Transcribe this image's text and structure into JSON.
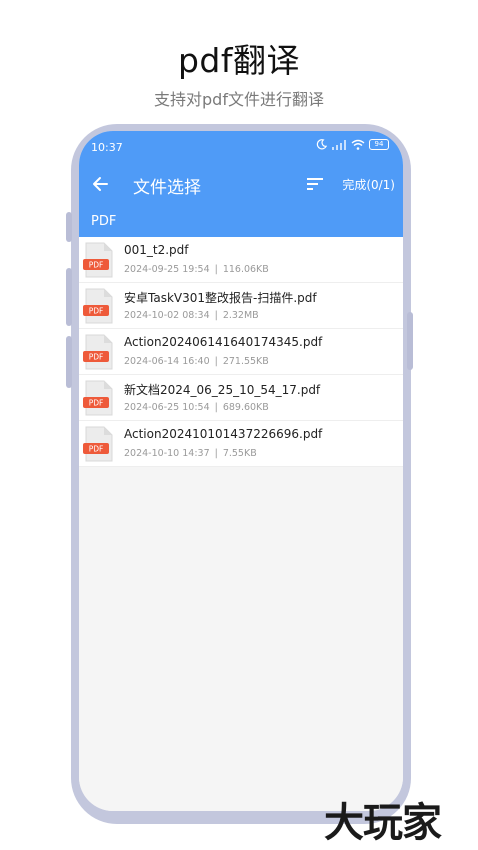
{
  "promo": {
    "title": "pdf翻译",
    "subtitle": "支持对pdf文件进行翻译"
  },
  "status_bar": {
    "time": "10:37",
    "battery": "94"
  },
  "toolbar": {
    "back_icon": "arrow-left-icon",
    "title": "文件选择",
    "sort_icon": "sort-icon",
    "done_label": "完成(0/1)"
  },
  "breadcrumb": "PDF",
  "files": [
    {
      "name": "001_t2.pdf",
      "date": "2024-09-25 19:54",
      "size": "116.06KB",
      "icon_label": "PDF"
    },
    {
      "name": "安卓TaskV301整改报告-扫描件.pdf",
      "date": "2024-10-02 08:34",
      "size": "2.32MB",
      "icon_label": "PDF"
    },
    {
      "name": "Action202406141640174345.pdf",
      "date": "2024-06-14 16:40",
      "size": "271.55KB",
      "icon_label": "PDF"
    },
    {
      "name": "新文档2024_06_25_10_54_17.pdf",
      "date": "2024-06-25 10:54",
      "size": "689.60KB",
      "icon_label": "PDF"
    },
    {
      "name": "Action202410101437226696.pdf",
      "date": "2024-10-10 14:37",
      "size": "7.55KB",
      "icon_label": "PDF"
    }
  ],
  "watermark": "大玩家",
  "colors": {
    "accent": "#4f9bf7",
    "pdf_badge": "#ee5a3a",
    "frame": "#c3c7dd"
  }
}
